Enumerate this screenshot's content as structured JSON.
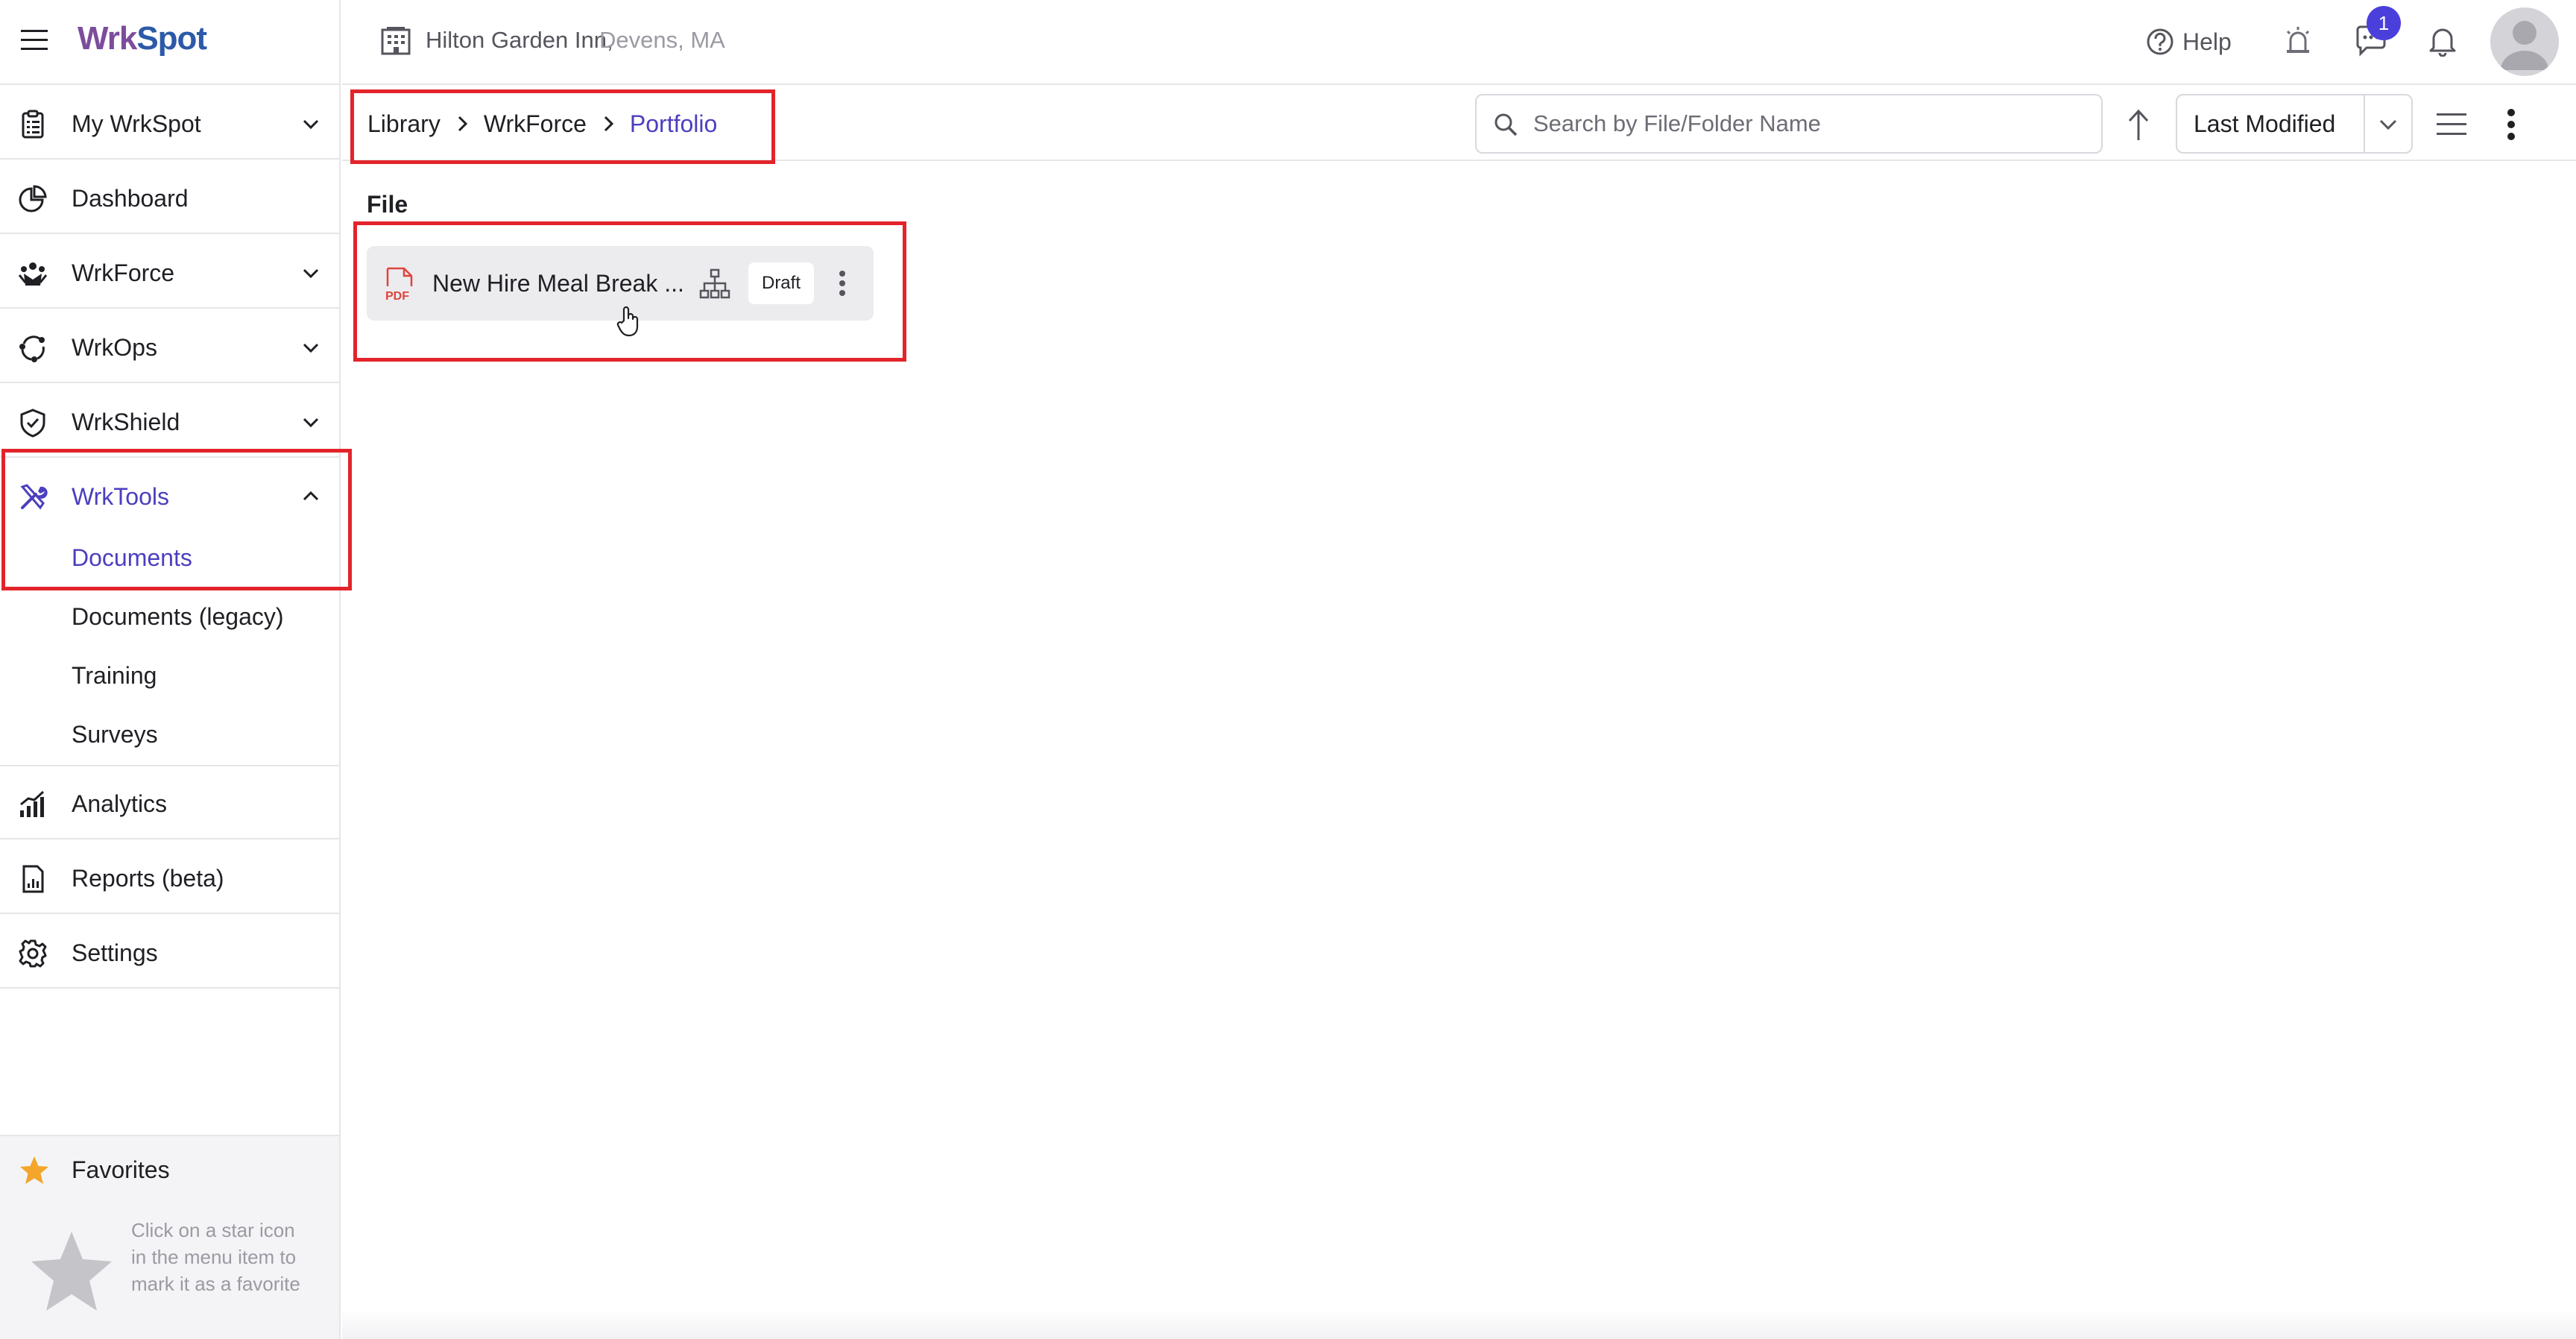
{
  "app": {
    "brand_wrk": "Wrk",
    "brand_spot": "Spot"
  },
  "header": {
    "hotel_name": "Hilton Garden Inn,",
    "hotel_location": "Devens, MA",
    "help_label": "Help",
    "chat_badge": "1"
  },
  "sidebar": {
    "items": [
      {
        "label": "My WrkSpot",
        "icon": "clipboard-icon",
        "expandable": true
      },
      {
        "label": "Dashboard",
        "icon": "pie-chart-icon",
        "expandable": false
      },
      {
        "label": "WrkForce",
        "icon": "team-icon",
        "expandable": true
      },
      {
        "label": "WrkOps",
        "icon": "cycle-icon",
        "expandable": true
      },
      {
        "label": "WrkShield",
        "icon": "shield-icon",
        "expandable": true
      },
      {
        "label": "WrkTools",
        "icon": "tools-icon",
        "expandable": true,
        "expanded": true,
        "active": true
      },
      {
        "label": "Analytics",
        "icon": "bar-chart-icon",
        "expandable": false
      },
      {
        "label": "Reports (beta)",
        "icon": "report-icon",
        "expandable": false
      },
      {
        "label": "Settings",
        "icon": "gear-icon",
        "expandable": false
      }
    ],
    "subitems": [
      {
        "label": "Documents",
        "active": true
      },
      {
        "label": "Documents (legacy)",
        "active": false
      },
      {
        "label": "Training",
        "active": false
      },
      {
        "label": "Surveys",
        "active": false
      }
    ],
    "favorites": {
      "label": "Favorites",
      "hint": "Click on a star icon in the menu item to mark it as a favorite"
    }
  },
  "toolbar": {
    "breadcrumb": [
      "Library",
      "WrkForce",
      "Portfolio"
    ],
    "search_placeholder": "Search by File/Folder Name",
    "sort_label": "Last Modified"
  },
  "content": {
    "section_label": "File",
    "files": [
      {
        "name": "New Hire Meal Break ...",
        "type": "PDF",
        "status": "Draft"
      }
    ]
  },
  "colors": {
    "accent": "#4b3fbf",
    "badge": "#4b3fdc",
    "highlight": "#e3242b",
    "pdf": "#e0433c",
    "favorite_star": "#f4a52b"
  }
}
